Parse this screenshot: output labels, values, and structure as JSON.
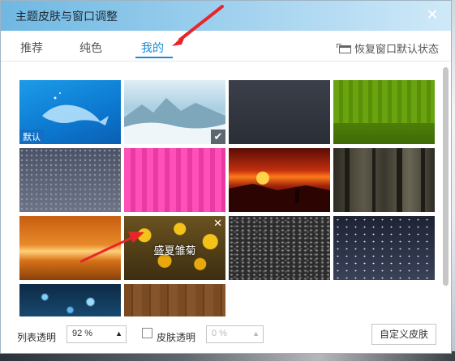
{
  "window": {
    "title": "主题皮肤与窗口调整",
    "close_icon": "close-icon"
  },
  "tabs": [
    {
      "label": "推荐",
      "active": false
    },
    {
      "label": "纯色",
      "active": false
    },
    {
      "label": "我的",
      "active": true
    }
  ],
  "restore_label": "恢复窗口默认状态",
  "skins": [
    {
      "id": "whale",
      "badge": "默认",
      "selected": false
    },
    {
      "id": "misty-mountains",
      "selected": true
    },
    {
      "id": "dark-slate"
    },
    {
      "id": "green-stripes"
    },
    {
      "id": "slate-dots"
    },
    {
      "id": "pink-stripes"
    },
    {
      "id": "red-sunset"
    },
    {
      "id": "dark-forest"
    },
    {
      "id": "orange-glow"
    },
    {
      "id": "summer-daisy",
      "name": "盛夏雏菊",
      "hover": true
    },
    {
      "id": "grey-doodles"
    },
    {
      "id": "night-stars"
    },
    {
      "id": "blue-bokeh"
    },
    {
      "id": "wood"
    }
  ],
  "footer": {
    "list_transparency_label": "列表透明",
    "list_transparency_value": "92 %",
    "skin_transparency_label": "皮肤透明",
    "skin_transparency_value": "0 %",
    "custom_skin_label": "自定义皮肤"
  },
  "colors": {
    "accent": "#1a8ad7",
    "annotation": "#e8262a"
  }
}
